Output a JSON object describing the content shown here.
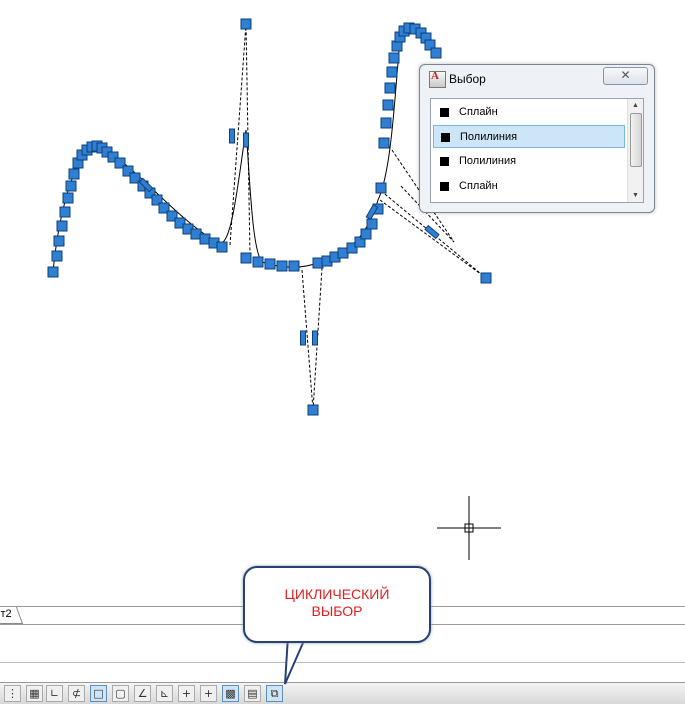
{
  "dialog": {
    "title": "Выбор",
    "close_glyph": "✕",
    "items": [
      {
        "label": "Сплайн",
        "selected": false
      },
      {
        "label": "Полилиния",
        "selected": true
      },
      {
        "label": "Полилиния",
        "selected": false
      },
      {
        "label": "Сплайн",
        "selected": false
      }
    ]
  },
  "layout_tab": {
    "label": "т2"
  },
  "callout": {
    "text": "ЦИКЛИЧЕСКИЙ\nВЫБОР"
  },
  "statusbar": {
    "buttons": [
      {
        "name": "model-icon",
        "glyph": "⋮",
        "on": false
      },
      {
        "name": "grid-icon",
        "glyph": "▦",
        "on": false
      },
      {
        "name": "ortho-icon",
        "glyph": "∟",
        "on": false
      },
      {
        "name": "polar-tracking-icon",
        "glyph": "⊄",
        "on": false
      },
      {
        "name": "object-snap-icon",
        "glyph": "□",
        "on": true
      },
      {
        "name": "3d-snap-icon",
        "glyph": "▢",
        "on": false
      },
      {
        "name": "object-tracking-icon",
        "glyph": "∠",
        "on": false
      },
      {
        "name": "dynamic-ucs-icon",
        "glyph": "⊾",
        "on": false
      },
      {
        "name": "dynamic-input-icon",
        "glyph": "+",
        "on": false
      },
      {
        "name": "lineweight-icon",
        "glyph": "+",
        "on": false
      },
      {
        "name": "transparency-icon",
        "glyph": "▩",
        "on": true
      },
      {
        "name": "quick-properties-icon",
        "glyph": "▤",
        "on": false
      },
      {
        "name": "selection-cycling-icon",
        "glyph": "⧉",
        "on": true
      }
    ]
  },
  "colors": {
    "grip": "#2f7fd3",
    "grip_border": "#0d3f7a",
    "callout_text": "#e02020",
    "selected_row": "#cde6f7"
  }
}
